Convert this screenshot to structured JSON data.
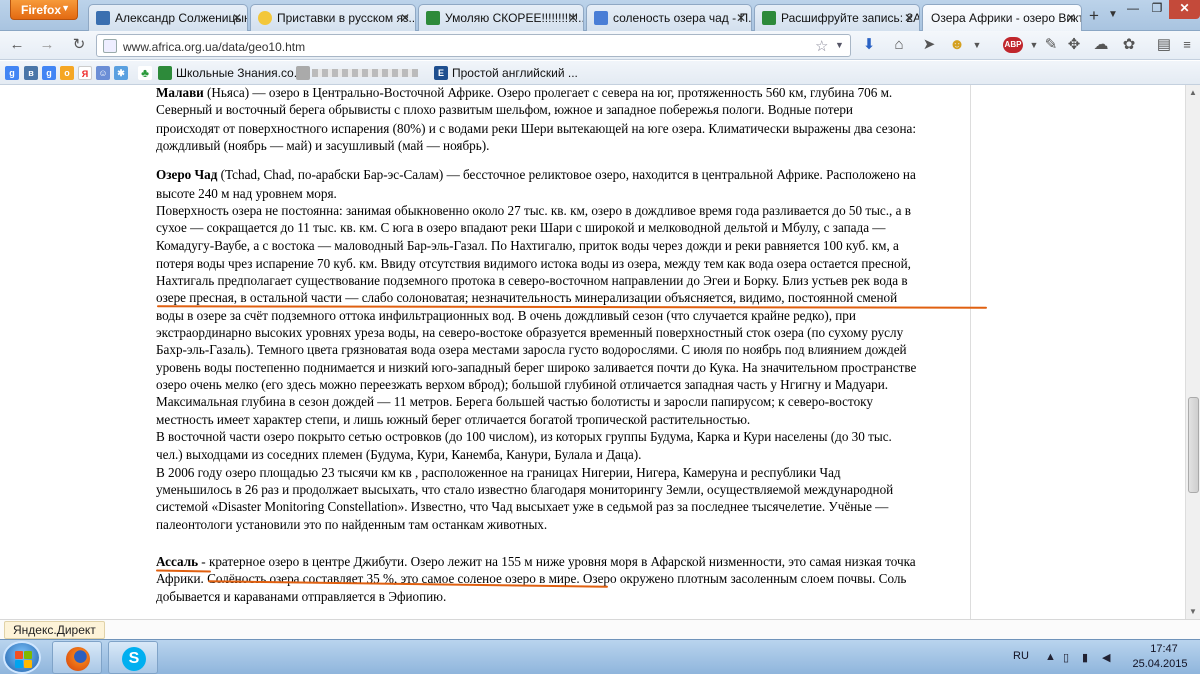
{
  "browser": {
    "menu_button": "Firefox",
    "tabs": [
      {
        "title": "Александр Солженицын..."
      },
      {
        "title": "Приставки в русском яз..."
      },
      {
        "title": "Умоляю СКОРЕЕ!!!!!!!!!!!..."
      },
      {
        "title": "соленость озера чад - П..."
      },
      {
        "title": "Расшифруйте запись: 2А..."
      },
      {
        "title": "Озера Африки - озеро Викт..."
      }
    ],
    "url": "www.africa.org.ua/data/geo10.htm",
    "bookmarks": [
      {
        "label": "Школьные Знания.co..."
      },
      {
        "label": "Простой английский ..."
      }
    ]
  },
  "article": {
    "lines": [
      {
        "segments": [
          {
            "b": true,
            "t": "Малави"
          },
          {
            "t": " (Ньяса) — озеро в Центрально-Восточной Африке. Озеро пролегает с севера на юг, протяженность 560 км, глубина 706 м."
          }
        ]
      },
      {
        "segments": [
          {
            "t": "Северный и восточный берега обрывисты с плохо развитым шельфом, южное и западное побережья пологи. Водные потери"
          }
        ]
      },
      {
        "segments": [
          {
            "t": "происходят от поверхностного испарения (80%) и с водами реки Шери вытекающей на юге озера. Климатически выражены два сезона:"
          }
        ]
      },
      {
        "segments": [
          {
            "t": "дождливый (ноябрь — май) и засушливый (май — ноябрь)."
          }
        ]
      },
      {
        "segments": [
          {
            "b": true,
            "t": "Озеро Чад"
          },
          {
            "t": " (Tchad, Chad, по-арабски Бар-эс-Салам) — бессточное реликтовое озеро, находится в центральной Африке. Расположено на"
          }
        ]
      },
      {
        "segments": [
          {
            "t": "высоте 240 м над уровнем моря."
          }
        ]
      },
      {
        "segments": [
          {
            "t": "Поверхность озера не постоянна: занимая обыкновенно около 27 тыс. кв. км, озеро в дождливое время года разливается до 50 тыс., а в"
          }
        ]
      },
      {
        "segments": [
          {
            "t": "сухое — сокращается до 11 тыс. кв. км. С юга в озеро впадают реки Шари с широкой и мелководной дельтой и Мбулу, с запада —"
          }
        ]
      },
      {
        "segments": [
          {
            "t": "Комадугу-Ваубе, а с востока — маловодный Бар-эль-Газал. По Нахтигалю, приток воды через дожди и реки равняется 100 куб. км, а"
          }
        ]
      },
      {
        "segments": [
          {
            "t": "потеря воды чрез испарение 70 куб. км. Ввиду отсутствия видимого истока воды из озера, между тем как вода озера остается пресной,"
          }
        ]
      },
      {
        "segments": [
          {
            "t": "Нахтигаль предполагает существование подземного протока в северо-восточном направлении до Эгеи и Борку. Близ устьев рек вода в"
          }
        ]
      },
      {
        "segments": [
          {
            "t": "озере пресная, в остальной части — слабо солоноватая; незначительность минерализации объясняется, видимо, постоянной сменой"
          }
        ]
      },
      {
        "segments": [
          {
            "t": "воды в озере за счёт подземного оттока инфильтрационных вод. В очень дождливый сезон (что случается крайне редко), при"
          }
        ]
      },
      {
        "segments": [
          {
            "t": "экстраординарно высоких уровнях уреза воды, на северо-востоке образуется временный поверхностный сток озера (по сухому руслу"
          }
        ]
      },
      {
        "segments": [
          {
            "t": "Бахр-эль-Газаль). Темного цвета грязноватая вода озера местами заросла густо водорослями. С июля по ноябрь под влиянием дождей"
          }
        ]
      },
      {
        "segments": [
          {
            "t": "уровень воды постепенно поднимается и низкий юго-западный берег широко заливается почти до Кука. На значительном пространстве"
          }
        ]
      },
      {
        "segments": [
          {
            "t": "озеро очень мелко (его здесь можно переезжать верхом вброд); большой глубиной отличается западная часть у Нгигну и Мадуари."
          }
        ]
      },
      {
        "segments": [
          {
            "t": "Максимальная глубина в сезон дождей — 11 метров. Берега большей частью болотисты и заросли папирусом; к северо-востоку"
          }
        ]
      },
      {
        "segments": [
          {
            "t": "местность имеет характер степи, и лишь южный берег отличается богатой тропической растительностью."
          }
        ]
      },
      {
        "segments": [
          {
            "t": "В восточной части озеро покрыто сетью островков (до 100 числом), из которых группы Будума, Карка и Кури населены (до 30 тыс."
          }
        ]
      },
      {
        "segments": [
          {
            "t": "чел.) выходцами из соседних племен (Будума, Кури, Канемба, Канури, Булала и Даца)."
          }
        ]
      },
      {
        "segments": [
          {
            "t": "В 2006 году озеро площадью 23 тысячи км кв , расположенное на границах Нигерии, Нигера, Камеруна и республики Чад"
          }
        ]
      },
      {
        "segments": [
          {
            "t": "уменьшилось в 26 раз и продолжает высыхать, что стало известно благодаря мониторингу Земли, осуществляемой международной"
          }
        ]
      },
      {
        "segments": [
          {
            "t": "системой «Disaster Monitoring Constellation». Известно, что Чад высыхает уже в седьмой раз за последнее тысячелетие. Учёные —"
          }
        ]
      },
      {
        "segments": [
          {
            "t": "палеонтологи установили это по найденным там останкам животных."
          }
        ]
      },
      {
        "segments": [
          {
            "b": true,
            "t": "Ассаль"
          },
          {
            "t": " - кратерное озеро в центре Джибути. Озеро лежит на 155 м ниже уровня моря в Афарской низменности, это самая низкая точка"
          }
        ]
      },
      {
        "segments": [
          {
            "t": "Африки. Солёность озера составляет 35 %, это самое соленое озеро в мире. Озеро окружено плотным засоленным слоем почвы. Соль"
          }
        ]
      },
      {
        "segments": [
          {
            "t": "добывается и караванами отправляется в Эфиопию."
          }
        ]
      }
    ]
  },
  "status": {
    "yandex_direct": "Яндекс.Директ"
  },
  "taskbar": {
    "tray_lang": "RU",
    "time": "17:47",
    "date": "25.04.2015"
  }
}
